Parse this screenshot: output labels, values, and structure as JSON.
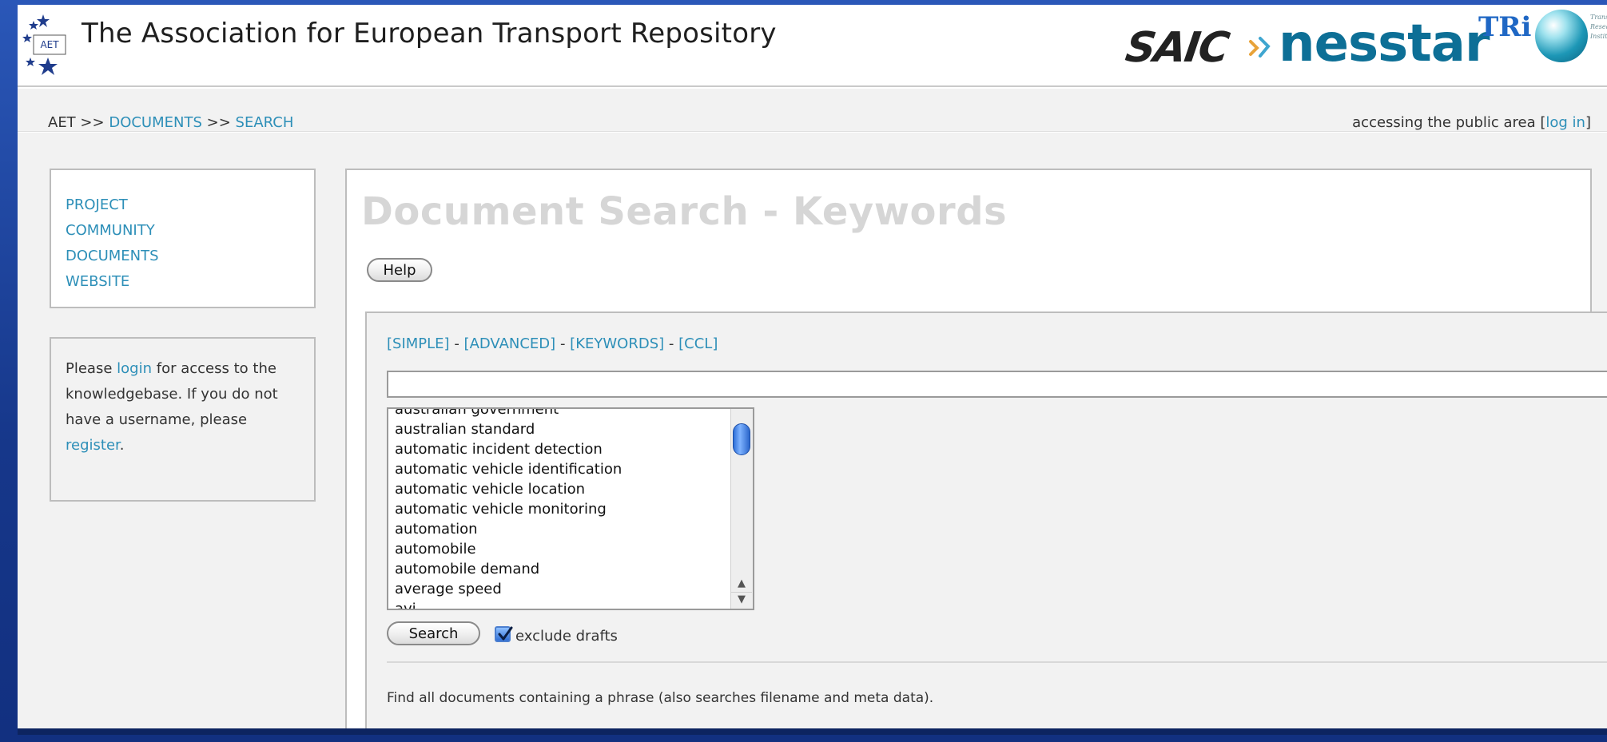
{
  "header": {
    "title": "The Association for European Transport Repository",
    "aet_logo_text": "AET",
    "partner_logos": {
      "saic": "SAIC",
      "nesstar": "nesstar",
      "tri": "TRi",
      "tri_caption": [
        "Transport",
        "Research",
        "Institute"
      ]
    }
  },
  "breadcrumb": {
    "items": [
      "AET",
      "DOCUMENTS",
      "SEARCH"
    ],
    "separator": ">>"
  },
  "access": {
    "prefix": "accessing the public area",
    "login_link": "log in"
  },
  "sidebar": {
    "menu": [
      "PROJECT",
      "COMMUNITY",
      "DOCUMENTS",
      "WEBSITE"
    ],
    "login_notice": {
      "t1": "Please",
      "link1": "login",
      "t2": "for access to the knowledgebase. If you do not have a username, please",
      "link2": "register",
      "t3": "."
    }
  },
  "main": {
    "page_title": "Document Search - Keywords",
    "help_label": "Help",
    "modes": [
      "[SIMPLE]",
      "[ADVANCED]",
      "[KEYWORDS]",
      "[CCL]"
    ],
    "mode_separator": "-",
    "search_value": "",
    "keywords": [
      "australian government",
      "australian standard",
      "automatic incident detection",
      "automatic vehicle identification",
      "automatic vehicle location",
      "automatic vehicle monitoring",
      "automation",
      "automobile",
      "automobile demand",
      "average speed",
      "avi"
    ],
    "search_label": "Search",
    "exclude_drafts_label": "exclude drafts",
    "exclude_drafts_checked": true,
    "hint": "Find all documents containing a phrase (also searches filename and meta data)."
  },
  "colors": {
    "link": "#2d8fb8",
    "title_grey": "#d6d6d6",
    "desktop_blue": "#1b3f8f"
  }
}
